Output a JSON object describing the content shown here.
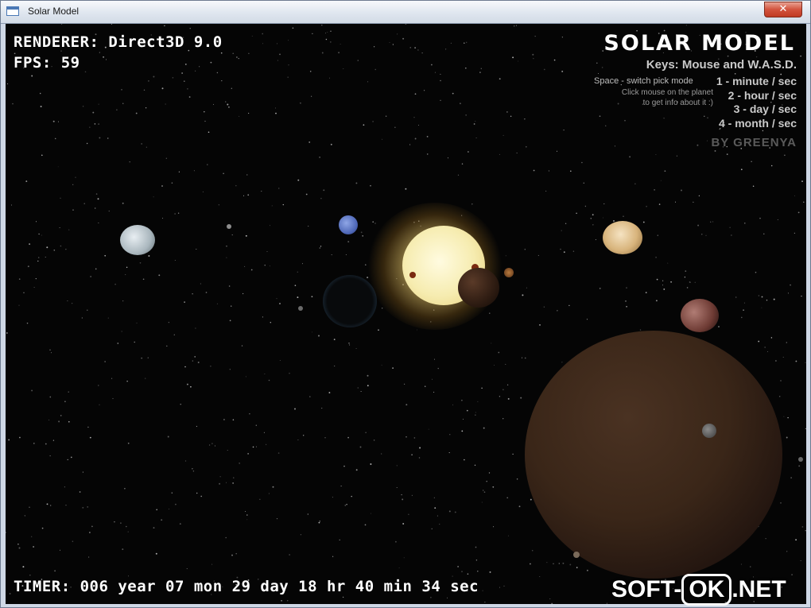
{
  "window": {
    "title": "Solar Model",
    "close_glyph": "✕"
  },
  "hud": {
    "renderer": "RENDERER: Direct3D 9.0",
    "fps": "FPS: 59",
    "timer": "TIMER: 006 year 07 mon 29 day 18 hr 40 min 34 sec"
  },
  "info_panel": {
    "logo": "SOLAR MODEL",
    "keys": "Keys:  Mouse and W.A.S.D.",
    "pick_mode": "Space - switch pick mode",
    "click_hint_1": "Click mouse on the planet",
    "click_hint_2": "to get info about it :)",
    "speeds": [
      "1 - minute / sec",
      "2 - hour / sec",
      "3 - day / sec",
      "4 - month / sec"
    ],
    "author": "BY GREENYA"
  },
  "watermark": {
    "prefix": "SOFT-",
    "boxed": "OK",
    "suffix": ".NET"
  },
  "colors": {
    "space": "#050505",
    "sun": "#f6ecb0",
    "hud_text": "#ffffff"
  }
}
